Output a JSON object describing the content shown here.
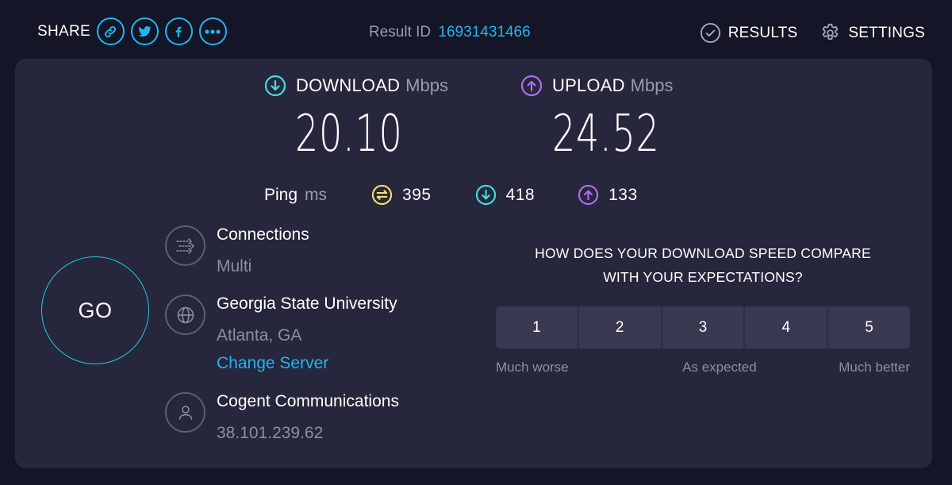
{
  "header": {
    "share_label": "SHARE",
    "share_buttons": [
      {
        "icon": "link-icon",
        "label": "Copy link"
      },
      {
        "icon": "twitter-icon",
        "label": "Twitter"
      },
      {
        "icon": "facebook-icon",
        "label": "Facebook"
      },
      {
        "icon": "more-icon",
        "label": "More"
      }
    ],
    "result_id_label": "Result ID",
    "result_id": "16931431466",
    "nav": [
      {
        "icon": "check-circle-icon",
        "label": "RESULTS"
      },
      {
        "icon": "gear-icon",
        "label": "SETTINGS"
      }
    ]
  },
  "speeds": {
    "download": {
      "label": "DOWNLOAD",
      "unit": "Mbps",
      "value": "20.10",
      "color": "#3ee0e0"
    },
    "upload": {
      "label": "UPLOAD",
      "unit": "Mbps",
      "value": "24.52",
      "color": "#b56cf0"
    }
  },
  "ping": {
    "label": "Ping",
    "unit": "ms",
    "idle": {
      "value": "395",
      "color": "#f5df6b"
    },
    "download": {
      "value": "418",
      "color": "#3ee0e0"
    },
    "upload": {
      "value": "133",
      "color": "#b56cf0"
    }
  },
  "go_button": {
    "label": "GO"
  },
  "info": {
    "connections": {
      "title": "Connections",
      "value": "Multi"
    },
    "server": {
      "title": "Georgia State University",
      "location": "Atlanta, GA",
      "change_link": "Change Server"
    },
    "provider": {
      "title": "Cogent Communications",
      "ip": "38.101.239.62"
    }
  },
  "survey": {
    "question_line1": "HOW DOES YOUR DOWNLOAD SPEED COMPARE",
    "question_line2": "WITH YOUR EXPECTATIONS?",
    "options": [
      "1",
      "2",
      "3",
      "4",
      "5"
    ],
    "scale_labels": {
      "low": "Much worse",
      "mid": "As expected",
      "high": "Much better"
    }
  },
  "colors": {
    "accent": "#1fb6f0",
    "background": "#141526",
    "panel": "#26273c"
  }
}
